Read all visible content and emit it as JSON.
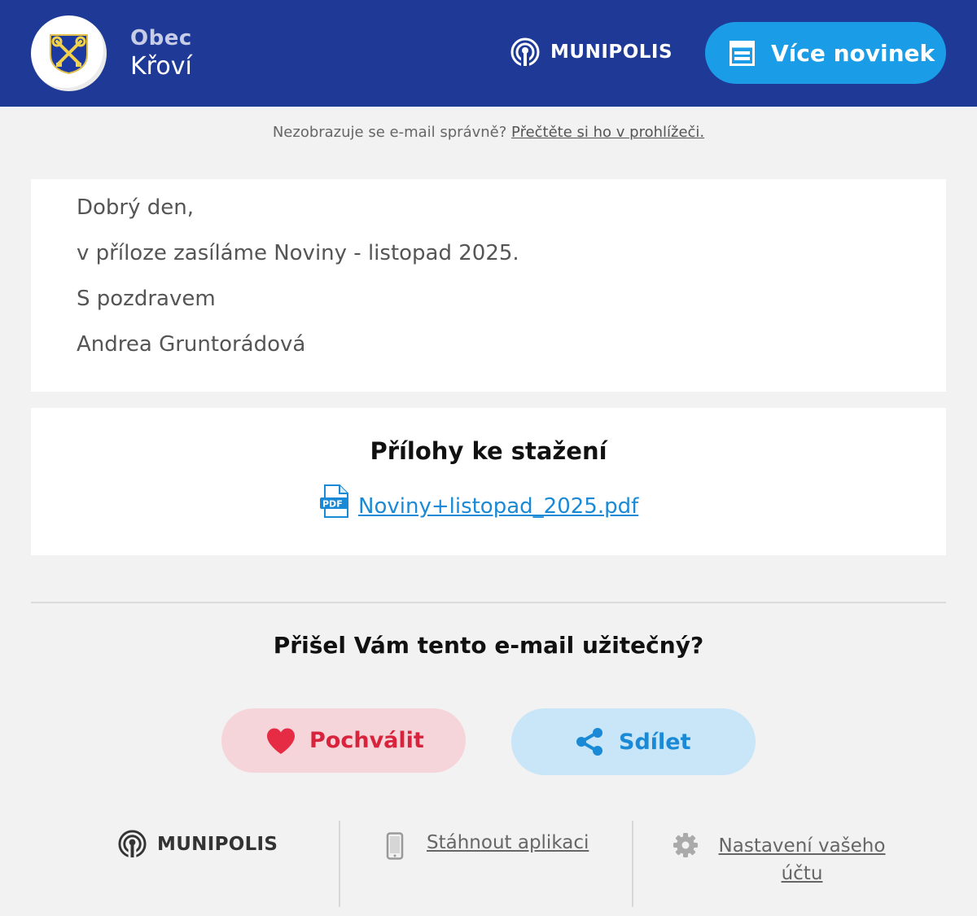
{
  "header": {
    "town_type": "Obec",
    "town_name": "Křoví",
    "platform": "MUNIPOLIS",
    "more_news_label": "Více novinek",
    "colors": {
      "background": "#1e3a96",
      "button": "#1a9ce6"
    }
  },
  "notice": {
    "text": "Nezobrazuje se e-mail správně?",
    "link": "Přečtěte si ho v prohlížeči."
  },
  "message": {
    "lines": [
      "Dobrý den,",
      "v příloze zasíláme Noviny - listopad 2025.",
      "S pozdravem",
      "Andrea Gruntorádová"
    ]
  },
  "attachments": {
    "title": "Přílohy ke stažení",
    "files": [
      {
        "name": "Noviny+listopad_2025.pdf",
        "icon": "pdf-file-icon"
      }
    ]
  },
  "feedback": {
    "question": "Přišel Vám tento e-mail užitečný?",
    "like_label": "Pochválit",
    "share_label": "Sdílet",
    "colors": {
      "like": "#d8233c",
      "share": "#1a8ad6"
    }
  },
  "footer": {
    "platform": "MUNIPOLIS",
    "download_app": "Stáhnout aplikaci",
    "account_settings": "Nastavení vašeho účtu"
  }
}
